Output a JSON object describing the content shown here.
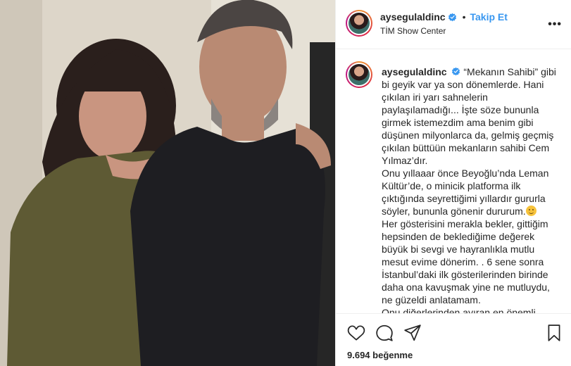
{
  "post": {
    "header": {
      "username": "aysegulaldinc",
      "separator": "•",
      "follow_label": "Takip Et",
      "location": "TİM Show Center",
      "more_label": "•••"
    },
    "caption": {
      "username": "aysegulaldinc",
      "paragraphs": [
        "“Mekanın Sahibi” gibi bi geyik var ya son dönemlerde. Hani çıkılan iri yarı sahnelerin paylaşılamadığı... İşte söze bununla girmek istemezdim ama benim gibi düşünen milyonlarca da, gelmiş geçmiş çıkılan büttüün mekanların sahibi Cem Yılmaz’dır.",
        "Onu yıllaaar önce Beyoğlu’nda Leman Kültür’de, o minicik platforma ilk çıktığında seyrettiğimi yıllardır gururla söyler, bununla gönenir dururum.",
        "Her gösterisini merakla bekler, gittiğim hepsinden de beklediğime değerek büyük bi sevgi ve hayranlıkla mutlu mesut evime dönerim. . 6 sene sonra İstanbul’daki ilk gösterilerinden birinde daha ona kavuşmak yine ne mutluydu, ne güzeldi anlatamam.",
        "Onu diğerlerinden ayıran en önemli"
      ]
    },
    "likes": "9.694 beğenme",
    "colors": {
      "link": "#3897f0",
      "verified": "#3897f0",
      "text": "#262626",
      "divider": "#efefef"
    },
    "icons": [
      "heart-icon",
      "comment-icon",
      "share-icon",
      "bookmark-icon",
      "verified-icon",
      "more-icon",
      "smile-emoji"
    ]
  }
}
